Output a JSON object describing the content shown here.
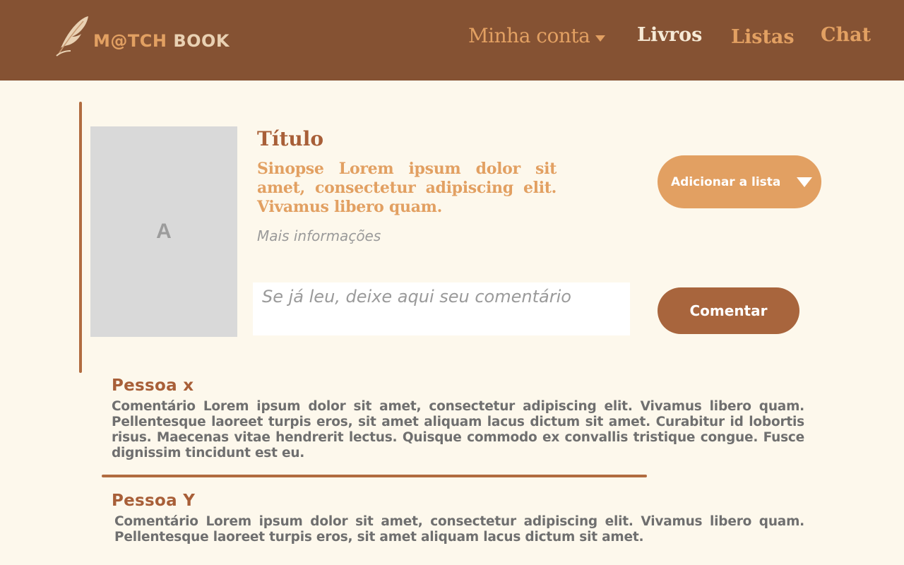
{
  "header": {
    "logo_text_accent": "M@TCH",
    "logo_text_light": "BOOK",
    "nav": {
      "account": "Minha conta",
      "books": "Livros",
      "lists": "Listas",
      "chat": "Chat"
    }
  },
  "book": {
    "cover_letter": "A",
    "title": "Título",
    "synopsis": "Sinopse Lorem ipsum dolor sit amet, consectetur adipiscing elit. Vivamus libero quam.",
    "more_info": "Mais informações",
    "add_to_list_label": "Adicionar a lista",
    "comment_placeholder": "Se já leu, deixe aqui seu comentário",
    "comment_button": "Comentar"
  },
  "comments": [
    {
      "author": "Pessoa x",
      "text": "Comentário Lorem ipsum dolor sit amet, consectetur adipiscing elit. Vivamus libero quam. Pellentesque laoreet turpis eros, sit amet aliquam lacus dictum sit amet. Curabitur id lobortis risus. Maecenas vitae hendrerit lectus. Quisque commodo ex convallis tristique congue. Fusce dignissim tincidunt est eu."
    },
    {
      "author": "Pessoa Y",
      "text": "Comentário Lorem ipsum dolor sit amet, consectetur adipiscing elit. Vivamus libero quam. Pellentesque laoreet turpis eros, sit amet aliquam lacus dictum sit amet."
    }
  ],
  "colors": {
    "header_bg": "#855233",
    "accent_orange": "#e2a062",
    "accent_brown": "#a85f38",
    "page_bg": "#fdf8ec",
    "cover_placeholder": "#d9d9d9"
  },
  "icons": {
    "logo": "feather-quill-icon",
    "account_dropdown": "caret-down-icon",
    "add_to_list_dropdown": "triangle-down-icon"
  }
}
